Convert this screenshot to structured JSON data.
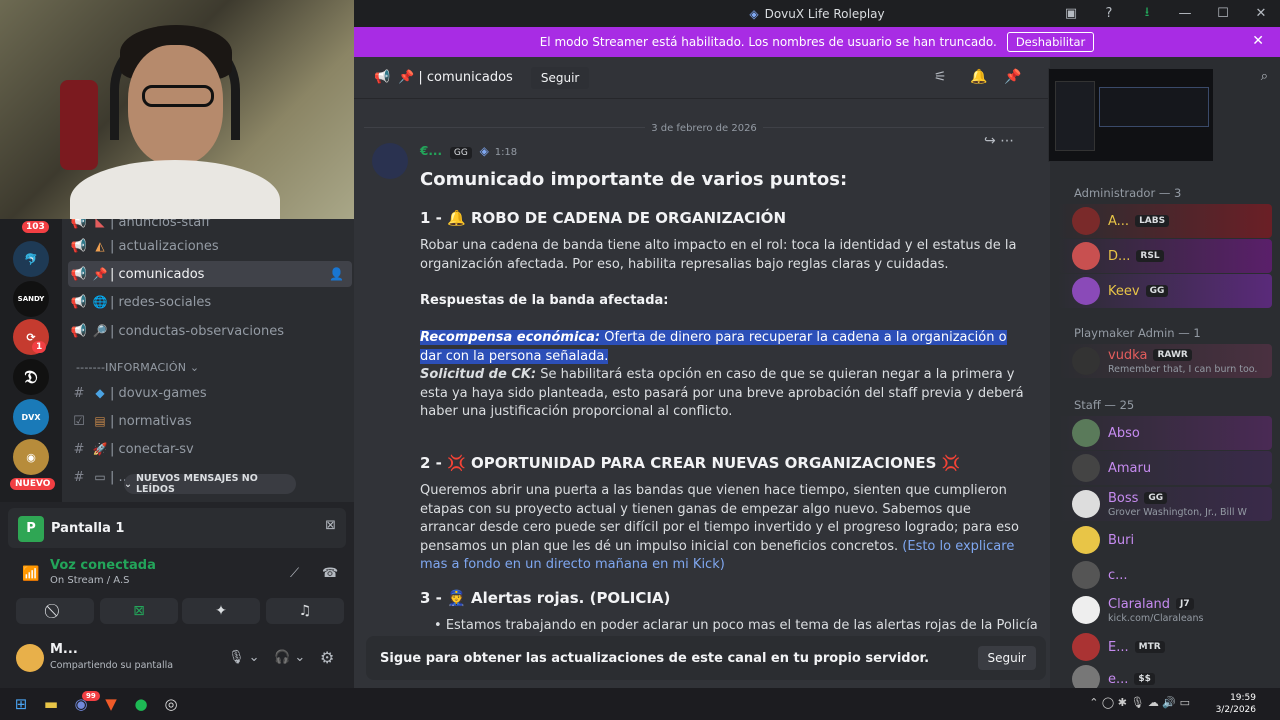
{
  "window": {
    "title": "DovuX Life Roleplay"
  },
  "banner": {
    "text": "El modo Streamer está habilitado. Los nombres de usuario se han truncado.",
    "button": "Deshabilitar"
  },
  "servers": {
    "mentions_badge": "103",
    "unread_badge": "1",
    "new_badge": "NUEVO",
    "sandy_label": "SANDY"
  },
  "channels": {
    "items": [
      {
        "name": "| anuncios-staff"
      },
      {
        "name": "| actualizaciones"
      },
      {
        "name": "| comunicados"
      },
      {
        "name": "| redes-sociales"
      },
      {
        "name": "| conductas-observaciones"
      },
      {
        "name": "| dovux-games"
      },
      {
        "name": "| normativas"
      },
      {
        "name": "| conectar-sv"
      },
      {
        "name": "| ..."
      }
    ],
    "category": "-------INFORMACIÓN",
    "new_messages": "NUEVOS MENSAJES NO LEÍDOS"
  },
  "voice": {
    "channel": "Pantalla 1",
    "status": "Voz conectada",
    "sub": "On Stream / A.S",
    "user": "M...",
    "user_status": "Compartiendo su pantalla"
  },
  "header": {
    "channel": "| comunicados",
    "follow": "Seguir"
  },
  "message": {
    "date": "3 de febrero de 2026",
    "author": "€...",
    "tag": "GG",
    "time": "1:18",
    "title": "Comunicado importante de varios puntos:",
    "s1_head": "1 - 🔔 ROBO DE CADENA DE ORGANIZACIÓN",
    "s1_p1": "Robar una cadena de banda tiene alto impacto en el rol: toca la identidad y el estatus de la organización afectada. Por eso, habilita represalias bajo reglas claras y cuidadas.",
    "s1_resp": "Respuestas de la banda afectada:",
    "s1_r1_label": "Recompensa económica:",
    "s1_r1_text": " Oferta de dinero para recuperar la cadena a la organización o dar con la persona señalada.",
    "s1_r2_label": "Solicitud de CK:",
    "s1_r2_text": " Se habilitará esta opción en caso de que se quieran negar a la primera y esta ya haya sido planteada, esto pasará por una breve aprobación del staff previa y deberá haber una justificación proporcional al conflicto.",
    "s2_head": "2 - 💢 OPORTUNIDAD PARA CREAR NUEVAS ORGANIZACIONES 💢",
    "s2_p1": "Queremos abrir una puerta a las bandas que vienen hace tiempo, sienten que cumplieron etapas con su proyecto actual y tienen ganas de empezar algo nuevo. Sabemos que arrancar desde cero puede ser difícil por el tiempo invertido y el progreso logrado; para eso pensamos un plan que les dé un impulso inicial con beneficios concretos.",
    "s2_link": "(Esto lo explicare mas a fondo en un directo mañana en mi Kick)",
    "s3_head": "3 - 👮 Alertas rojas. (POLICIA)",
    "s3_b1": "Estamos trabajando en poder aclarar un poco mas el tema de las alertas rojas de la Policía cuando son"
  },
  "follow_bar": {
    "text": "Sigue para obtener las actualizaciones de este canal en tu propio servidor.",
    "button": "Seguir"
  },
  "members": {
    "cat_admin": "Administrador — 3",
    "cat_playmaker": "Playmaker Admin — 1",
    "cat_staff": "Staff — 25",
    "list": [
      {
        "name": "A...",
        "tag": "LABS",
        "color": "#e8c547"
      },
      {
        "name": "D...",
        "tag": "RSL",
        "color": "#e8c547"
      },
      {
        "name": "Keev",
        "tag": "GG",
        "color": "#e8c547"
      },
      {
        "name": "vudka",
        "tag": "RAWR",
        "color": "#e35d5d",
        "sub": "Remember that, I can burn too."
      },
      {
        "name": "Abso",
        "tag": "",
        "color": "#c68bf0"
      },
      {
        "name": "Amaru",
        "tag": "",
        "color": "#c68bf0"
      },
      {
        "name": "Boss",
        "tag": "GG",
        "color": "#c68bf0",
        "sub": "Grover Washington, Jr., Bill W"
      },
      {
        "name": "Buri",
        "tag": "",
        "color": "#c68bf0"
      },
      {
        "name": "c...",
        "tag": "",
        "color": "#c68bf0"
      },
      {
        "name": "Claraland",
        "tag": "J7",
        "color": "#c68bf0",
        "sub": "kick.com/Claraleans"
      },
      {
        "name": "E...",
        "tag": "MTR",
        "color": "#c68bf0"
      },
      {
        "name": "e...",
        "tag": "$$",
        "color": "#c68bf0"
      }
    ]
  },
  "taskbar": {
    "time": "19:59",
    "date": "3/2/2026",
    "discord_badge": "99"
  },
  "colors": {
    "banner": "#a82ce4",
    "selection": "#2c4fb8",
    "link": "#7fa7f0",
    "bg": "#313338"
  }
}
